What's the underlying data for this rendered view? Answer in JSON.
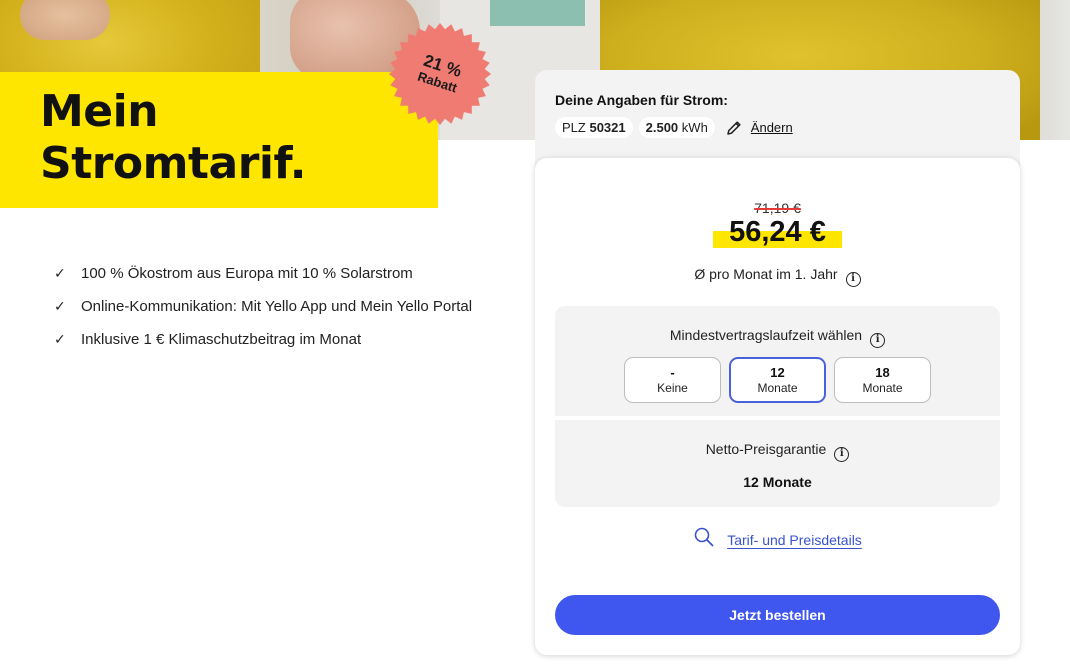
{
  "colors": {
    "brand_yellow": "#ffe600",
    "accent_blue": "#4057ef",
    "sticker": "#ef7b72",
    "strike_red": "#e53935"
  },
  "hero": {
    "title_line1": "Mein",
    "title_line2": "Stromtarif.",
    "sticker_percent": "21 %",
    "sticker_label": "Rabatt"
  },
  "benefits": [
    "100 % Ökostrom aus Europa mit 10 % Solarstrom",
    "Online-Kommunikation: Mit Yello App und Mein Yello Portal",
    "Inklusive 1 € Klimaschutzbeitrag im Monat"
  ],
  "inputs_panel": {
    "heading": "Deine Angaben für Strom:",
    "plz_label": "PLZ",
    "plz_value": "50321",
    "consumption_value": "2.500",
    "consumption_unit": "kWh",
    "edit_icon": "pencil-icon",
    "edit_label": "Ändern"
  },
  "price": {
    "old": "71,19 €",
    "new": "56,24 €",
    "note": "Ø pro Monat im 1. Jahr"
  },
  "term": {
    "title": "Mindestvertragslaufzeit wählen",
    "selected_index": 1,
    "options": [
      {
        "big": "-",
        "small": "Keine"
      },
      {
        "big": "12",
        "small": "Monate"
      },
      {
        "big": "18",
        "small": "Monate"
      }
    ]
  },
  "guarantee": {
    "title": "Netto-Preisgarantie",
    "value": "12 Monate"
  },
  "details_link": {
    "icon": "search-icon",
    "label": "Tarif- und Preisdetails"
  },
  "order_button": {
    "label": "Jetzt bestellen"
  }
}
